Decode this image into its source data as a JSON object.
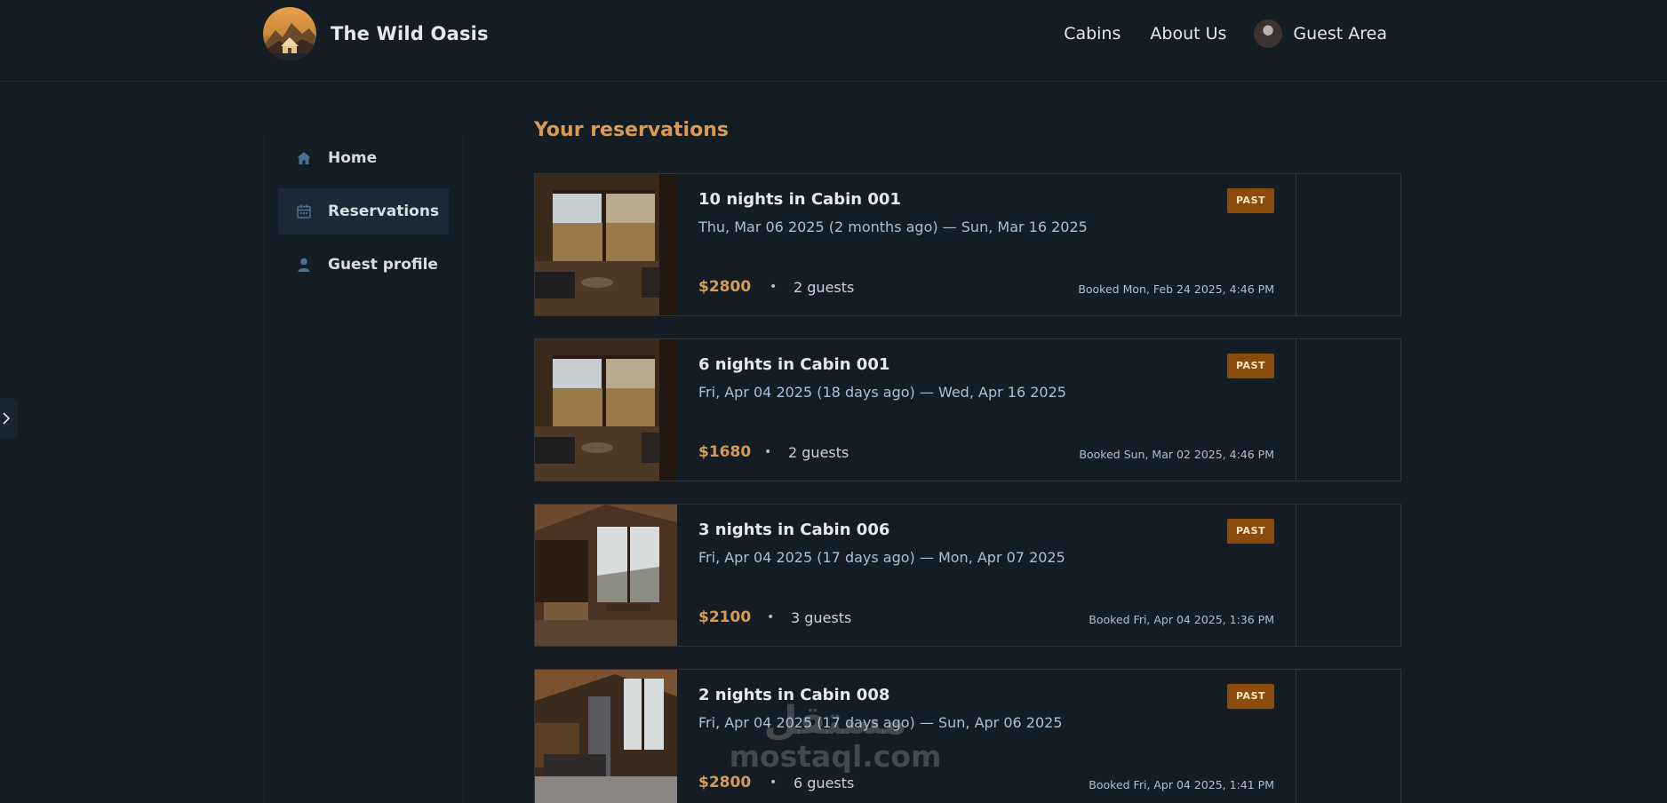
{
  "app": {
    "name": "The Wild Oasis"
  },
  "nav": {
    "cabins": "Cabins",
    "about": "About Us",
    "guest_area": "Guest Area"
  },
  "sidebar": {
    "items": [
      {
        "label": "Home",
        "icon": "home-icon",
        "active": false
      },
      {
        "label": "Reservations",
        "icon": "calendar-icon",
        "active": true
      },
      {
        "label": "Guest profile",
        "icon": "user-icon",
        "active": false
      }
    ]
  },
  "page": {
    "title": "Your reservations"
  },
  "reservations": [
    {
      "title": "10 nights in Cabin 001",
      "dates": "Thu, Mar 06 2025 (2 months ago) — Sun, Mar 16 2025",
      "price": "$2800",
      "dot": "•",
      "guests": "2 guests",
      "booked": "Booked Mon, Feb 24 2025, 4:46 PM",
      "status": "PAST"
    },
    {
      "title": "6 nights in Cabin 001",
      "dates": "Fri, Apr 04 2025 (18 days ago) — Wed, Apr 16 2025",
      "price": "$1680",
      "dot": "•",
      "guests": "2 guests",
      "booked": "Booked Sun, Mar 02 2025, 4:46 PM",
      "status": "PAST"
    },
    {
      "title": "3 nights in Cabin 006",
      "dates": "Fri, Apr 04 2025 (17 days ago) — Mon, Apr 07 2025",
      "price": "$2100",
      "dot": "•",
      "guests": "3 guests",
      "booked": "Booked Fri, Apr 04 2025, 1:36 PM",
      "status": "PAST"
    },
    {
      "title": "2 nights in Cabin 008",
      "dates": "Fri, Apr 04 2025 (17 days ago) — Sun, Apr 06 2025",
      "price": "$2800",
      "dot": "•",
      "guests": "6 guests",
      "booked": "Booked Fri, Apr 04 2025, 1:41 PM",
      "status": "PAST"
    }
  ],
  "watermark": {
    "arabic": "مستقل",
    "latin": "mostaql.com"
  },
  "colors": {
    "background": "#141c24",
    "accent": "#d99a55",
    "badge": "#8a4b0b",
    "muted_text": "#a9c0d6"
  }
}
